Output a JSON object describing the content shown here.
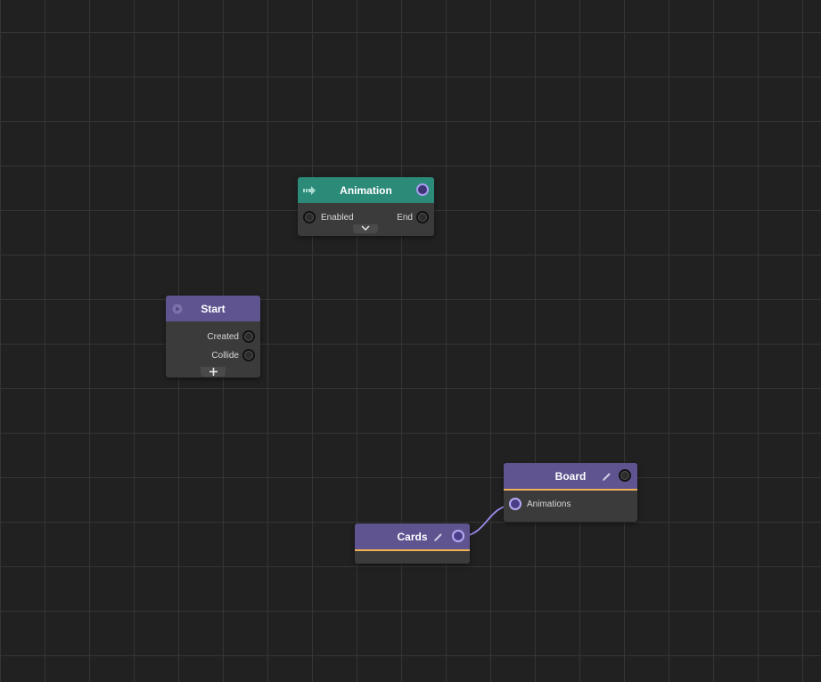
{
  "colors": {
    "canvas_background": "#212121",
    "grid_line": "#353535",
    "node_body": "#3b3b3b",
    "header_purple": "#5f5490",
    "header_teal": "#2c8a78",
    "accent_orange": "#f0b154",
    "wire": "#9c8ef0"
  },
  "nodes": {
    "animation": {
      "title": "Animation",
      "header_icon": "event-arrow-icon",
      "inputs": [
        "Enabled"
      ],
      "outputs": [
        "End"
      ],
      "toggle_icon": "chevron-down-icon"
    },
    "start": {
      "title": "Start",
      "header_icon": "play-icon",
      "outputs": [
        "Created",
        "Collide"
      ],
      "add_icon": "plus-icon"
    },
    "board": {
      "title": "Board",
      "edit_icon": "pencil-icon",
      "inputs": [
        "Animations"
      ]
    },
    "cards": {
      "title": "Cards",
      "edit_icon": "pencil-icon"
    }
  },
  "connections": [
    {
      "from": "Cards",
      "to": "Board.Animations"
    }
  ]
}
